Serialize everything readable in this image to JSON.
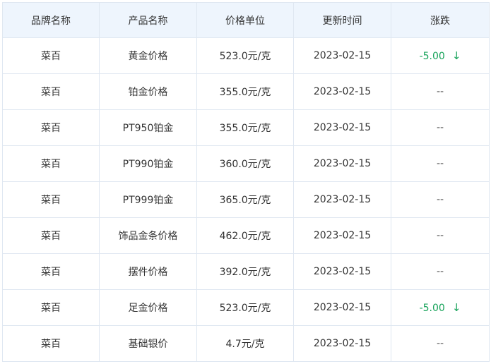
{
  "colors": {
    "header_bg": "#eef5fd",
    "border": "#dfe7f1",
    "down": "#17a35a",
    "text": "#333333"
  },
  "table": {
    "headers": [
      "品牌名称",
      "产品名称",
      "价格单位",
      "更新时间",
      "涨跌"
    ],
    "rows": [
      {
        "brand": "菜百",
        "product": "黄金价格",
        "price": "523.0元/克",
        "date": "2023-02-15",
        "change": "-5.00",
        "direction": "down",
        "arrow": "↓"
      },
      {
        "brand": "菜百",
        "product": "铂金价格",
        "price": "355.0元/克",
        "date": "2023-02-15",
        "change": "--",
        "direction": "none",
        "arrow": ""
      },
      {
        "brand": "菜百",
        "product": "PT950铂金",
        "price": "355.0元/克",
        "date": "2023-02-15",
        "change": "--",
        "direction": "none",
        "arrow": ""
      },
      {
        "brand": "菜百",
        "product": "PT990铂金",
        "price": "360.0元/克",
        "date": "2023-02-15",
        "change": "--",
        "direction": "none",
        "arrow": ""
      },
      {
        "brand": "菜百",
        "product": "PT999铂金",
        "price": "365.0元/克",
        "date": "2023-02-15",
        "change": "--",
        "direction": "none",
        "arrow": ""
      },
      {
        "brand": "菜百",
        "product": "饰品金条价格",
        "price": "462.0元/克",
        "date": "2023-02-15",
        "change": "--",
        "direction": "none",
        "arrow": ""
      },
      {
        "brand": "菜百",
        "product": "摆件价格",
        "price": "392.0元/克",
        "date": "2023-02-15",
        "change": "--",
        "direction": "none",
        "arrow": ""
      },
      {
        "brand": "菜百",
        "product": "足金价格",
        "price": "523.0元/克",
        "date": "2023-02-15",
        "change": "-5.00",
        "direction": "down",
        "arrow": "↓"
      },
      {
        "brand": "菜百",
        "product": "基础银价",
        "price": "4.7元/克",
        "date": "2023-02-15",
        "change": "--",
        "direction": "none",
        "arrow": ""
      }
    ]
  }
}
